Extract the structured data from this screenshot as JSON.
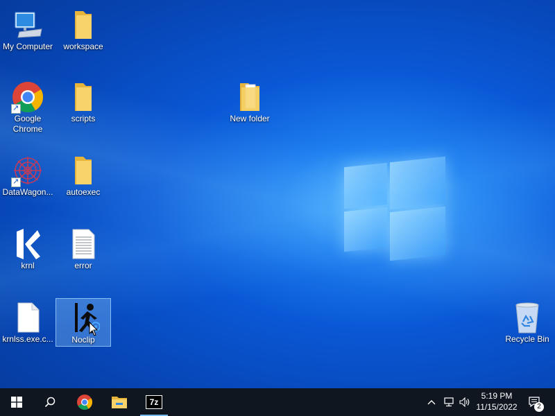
{
  "desktop": {
    "icons": {
      "my_computer": "My Computer",
      "workspace": "workspace",
      "google_chrome": "Google Chrome",
      "scripts": "scripts",
      "new_folder": "New folder",
      "datawagon": "DataWagon...",
      "autoexec": "autoexec",
      "krnl": "krnl",
      "error": "error",
      "krnlss": "krnlss.exe.c...",
      "noclip": "Noclip",
      "recycle_bin": "Recycle Bin"
    }
  },
  "taskbar": {
    "pinned": [
      "start-icon",
      "search-icon",
      "chrome-icon",
      "file-explorer-icon",
      "7zip-icon"
    ],
    "sevenzip_label": "7z",
    "clock": {
      "time": "5:19 PM",
      "date": "11/15/2022"
    },
    "notifications_count": "2"
  },
  "colors": {
    "taskbar_bg": "#0f1620",
    "accent": "#76b9ed",
    "folder": "#f3c94f"
  }
}
